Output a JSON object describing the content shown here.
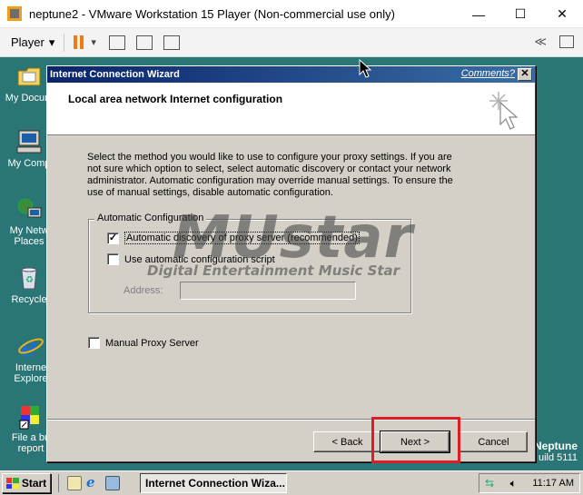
{
  "host": {
    "title": "neptune2 - VMware Workstation 15 Player (Non-commercial use only)",
    "player_menu": "Player",
    "controls": {
      "minimize": "—",
      "maximize": "☐",
      "close": "✕"
    },
    "collapse_glyph": "≪"
  },
  "desktop": {
    "icons": [
      {
        "label": "My Docum",
        "icon": "folder-documents-icon"
      },
      {
        "label": "My Comp",
        "icon": "computer-icon"
      },
      {
        "label": "My Netw Places",
        "icon": "network-icon"
      },
      {
        "label": "Recycle",
        "icon": "recycle-bin-icon"
      },
      {
        "label": "Interne Explore",
        "icon": "internet-explorer-icon"
      },
      {
        "label": "File a bu report",
        "icon": "bug-report-icon"
      }
    ],
    "brand_line1": "Neptune",
    "brand_line2": "uild 5111"
  },
  "wizard": {
    "title": "Internet Connection Wizard",
    "comments_link": "Comments?",
    "close": "✕",
    "heading": "Local area network Internet configuration",
    "description": "Select the method you would like to use to configure your proxy settings.  If you are not sure which option to select, select automatic discovery or contact your network administrator.  Automatic configuration may override manual settings.  To ensure the use of manual settings, disable automatic configuration.",
    "auto_group": {
      "title": "Automatic Configuration",
      "auto_discovery": {
        "label": "Automatic discovery of proxy server (recommended)",
        "checked": true
      },
      "auto_script": {
        "label": "Use automatic configuration script",
        "checked": false
      },
      "address_label": "Address:",
      "address_value": ""
    },
    "manual_proxy": {
      "label": "Manual Proxy Server",
      "checked": false
    },
    "buttons": {
      "back": "< Back",
      "next": "Next >",
      "cancel": "Cancel"
    }
  },
  "watermark": {
    "main": "MUstar",
    "sub": "Digital Entertainment Music Star"
  },
  "taskbar": {
    "start": "Start",
    "active_task": "Internet Connection Wiza...",
    "clock": "11:17 AM"
  },
  "colors": {
    "highlight": "#e01b24",
    "title_gradient_start": "#0a246a",
    "desktop": "#2a7575"
  }
}
